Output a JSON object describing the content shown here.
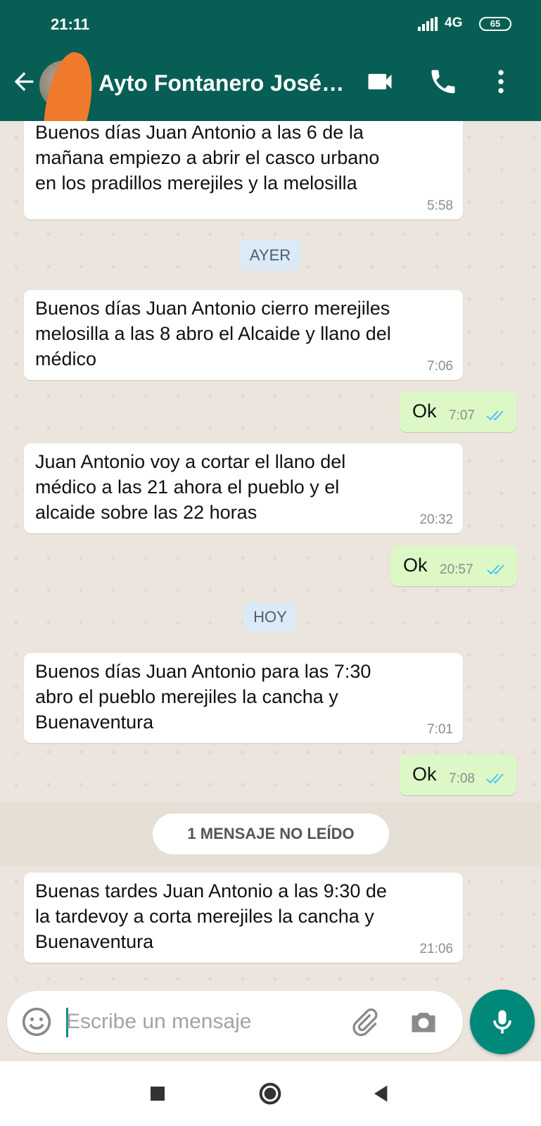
{
  "status_bar": {
    "time": "21:11",
    "network": "4G",
    "battery": "65"
  },
  "header": {
    "contact_name": "Ayto Fontanero José…",
    "icons": [
      "back-arrow-icon",
      "video-call-icon",
      "phone-icon",
      "more-vert-icon"
    ]
  },
  "date_labels": {
    "yesterday": "AYER",
    "today": "HOY"
  },
  "messages": [
    {
      "direction": "in",
      "text": "Buenos días Juan Antonio a las 6 de la\nmañana empiezo a abrir el casco urbano\nen los pradillos merejiles y la melosilla",
      "time": "5:58"
    },
    {
      "direction": "in",
      "text": "Buenos días Juan Antonio cierro merejiles\nmelosilla a las 8 abro el Alcaide y llano del\nmédico",
      "time": "7:06"
    },
    {
      "direction": "out",
      "text": "Ok",
      "time": "7:07",
      "status": "read"
    },
    {
      "direction": "in",
      "text": "Juan Antonio voy a cortar el llano del\nmédico a las 21 ahora el pueblo y el\nalcaide sobre las 22 horas",
      "time": "20:32"
    },
    {
      "direction": "out",
      "text": "Ok",
      "time": "20:57",
      "status": "read"
    },
    {
      "direction": "in",
      "text": "Buenos días Juan Antonio para las 7:30\nabro el pueblo merejiles la cancha y\nBuenaventura",
      "time": "7:01"
    },
    {
      "direction": "out",
      "text": "Ok",
      "time": "7:08",
      "status": "read"
    },
    {
      "direction": "in",
      "text": "Buenas tardes Juan Antonio a las 9:30 de\nla tardevoy a corta merejiles la cancha y\nBuenaventura",
      "time": "21:06"
    }
  ],
  "unread_banner": "1 MENSAJE NO LEÍDO",
  "composer": {
    "placeholder": "Escribe un mensaje",
    "icons": [
      "emoji-icon",
      "attach-icon",
      "camera-icon",
      "mic-icon"
    ]
  },
  "colors": {
    "header": "#075e54",
    "outgoing_bubble": "#dcf8c6",
    "incoming_bubble": "#ffffff",
    "read_ticks": "#4fc3f7",
    "accent": "#00897b"
  }
}
